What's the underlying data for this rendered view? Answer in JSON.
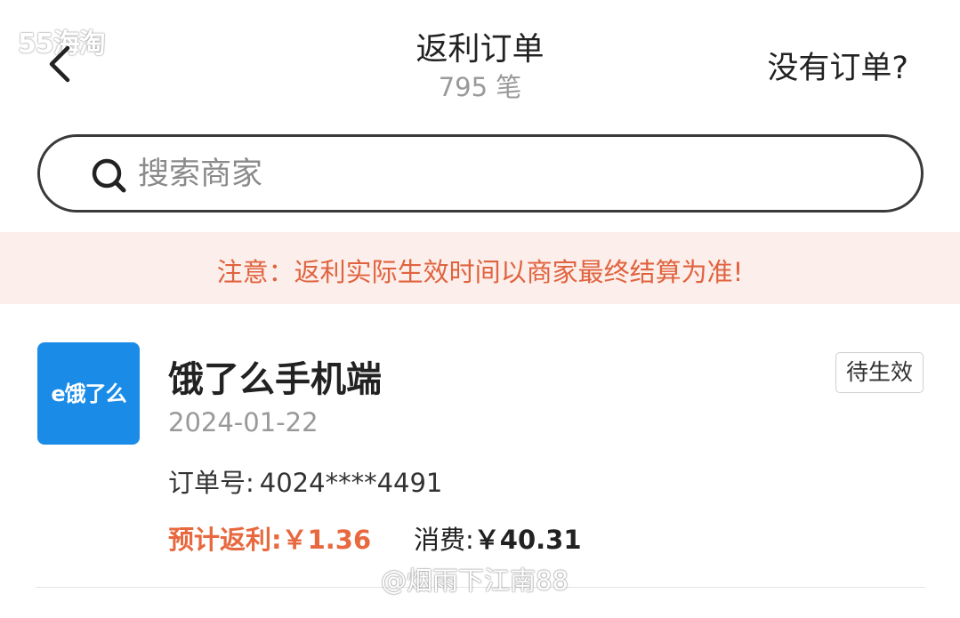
{
  "header": {
    "title": "返利订单",
    "subtitle": "795 笔",
    "help_link": "没有订单?"
  },
  "watermarks": {
    "top": "55海淘",
    "bottom": "@烟雨下江南88"
  },
  "search": {
    "placeholder": "搜索商家",
    "value": ""
  },
  "notice": {
    "text": "注意：返利实际生效时间以商家最终结算为准!"
  },
  "orders": [
    {
      "logo_text": "e饿了么",
      "merchant": "饿了么手机端",
      "date": "2024-01-22",
      "order_no_label": "订单号:",
      "order_no": "4024****4491",
      "rebate_label": "预计返利:",
      "rebate_value": "￥1.36",
      "spend_label": "消费:",
      "spend_value": "￥40.31",
      "status": "待生效"
    }
  ],
  "colors": {
    "accent": "#e8693f",
    "notice_bg": "#fceeea",
    "logo_bg": "#1a8ce8"
  },
  "icons": {
    "back": "chevron-left-icon",
    "search": "search-icon"
  }
}
